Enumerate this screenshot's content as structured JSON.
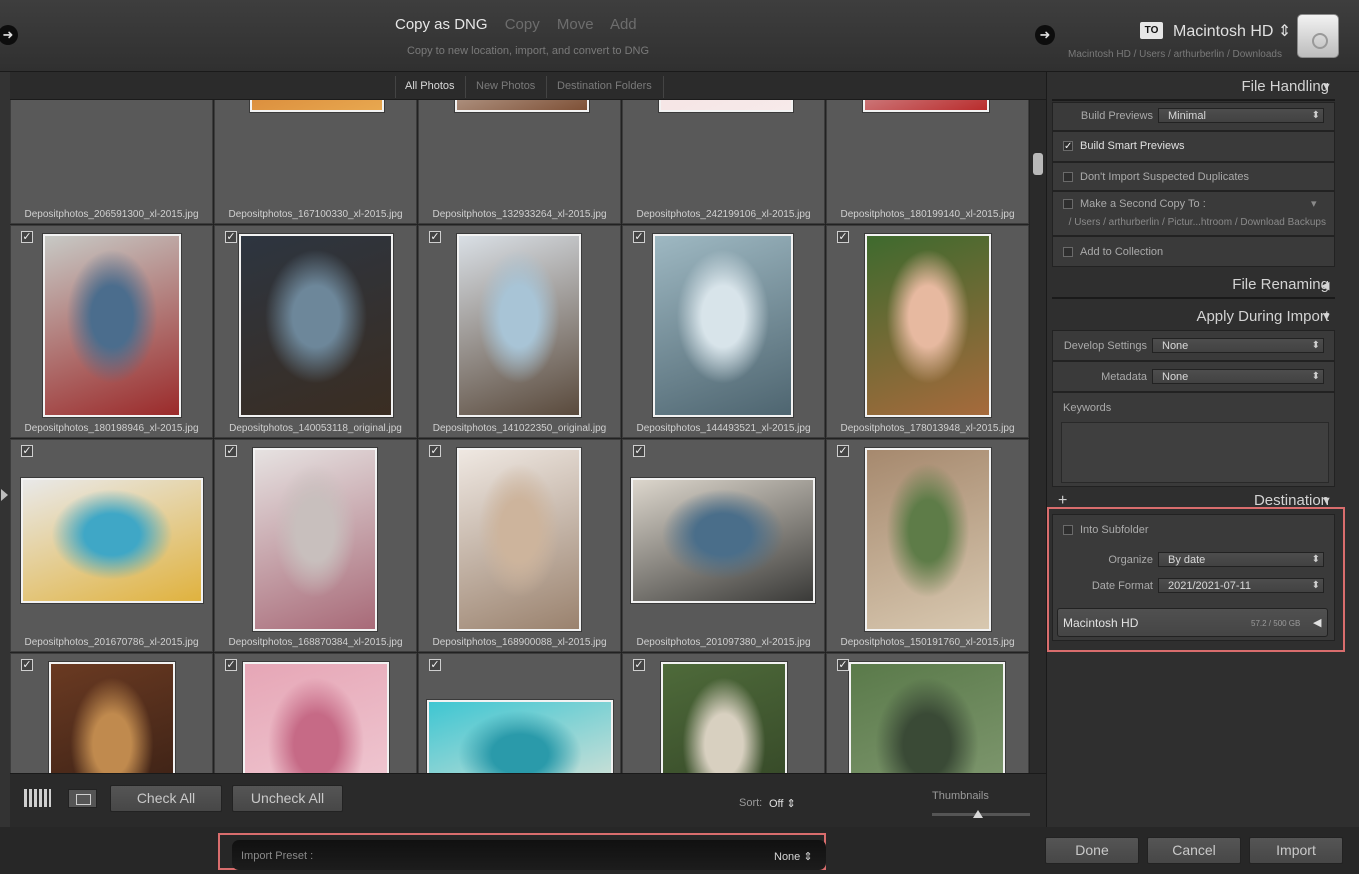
{
  "top": {
    "modes": [
      "Copy as DNG",
      "Copy",
      "Move",
      "Add"
    ],
    "active_mode": "Copy as DNG",
    "mode_description": "Copy to new location, import, and convert to DNG",
    "to_badge": "TO",
    "destination_name": "Macintosh HD ⇕",
    "destination_path": "Macintosh HD / Users / arthurberlin / Downloads",
    "nav_left_icon": "arrow-right-circle-icon",
    "nav_right_icon": "arrow-right-circle-icon",
    "disk_icon": "hard-drive-icon"
  },
  "grid_tabs": [
    "All Photos",
    "New Photos",
    "Destination Folders"
  ],
  "photos": [
    {
      "file": "Depositphotos_206591300_xl-2015.jpg",
      "checked": false,
      "colors": [
        "#b25a2a",
        "#e09a5a",
        "#6a3a1e"
      ]
    },
    {
      "file": "Depositphotos_167100330_xl-2015.jpg",
      "checked": false,
      "colors": [
        "#c96a23",
        "#7a3414",
        "#e8a850"
      ]
    },
    {
      "file": "Depositphotos_132933264_xl-2015.jpg",
      "checked": false,
      "colors": [
        "#efeae4",
        "#b9aca0",
        "#7e5036"
      ]
    },
    {
      "file": "Depositphotos_242199106_xl-2015.jpg",
      "checked": false,
      "colors": [
        "#f3dede",
        "#eeb6bd",
        "#f7eaea"
      ]
    },
    {
      "file": "Depositphotos_180199140_xl-2015.jpg",
      "checked": false,
      "colors": [
        "#e8e9ee",
        "#c6c9d2",
        "#b92b2b"
      ]
    },
    {
      "file": "Depositphotos_180198946_xl-2015.jpg",
      "checked": true,
      "colors": [
        "#c7c9c5",
        "#4b6d8d",
        "#9b2a2a"
      ]
    },
    {
      "file": "Depositphotos_140053118_original.jpg",
      "checked": true,
      "colors": [
        "#2d3540",
        "#6d879a",
        "#3a2d22"
      ]
    },
    {
      "file": "Depositphotos_141022350_original.jpg",
      "checked": true,
      "colors": [
        "#d9dfe5",
        "#a8c4d6",
        "#5a4a3c"
      ]
    },
    {
      "file": "Depositphotos_144493521_xl-2015.jpg",
      "checked": true,
      "colors": [
        "#9eb8c2",
        "#d8e4ea",
        "#4e6570"
      ]
    },
    {
      "file": "Depositphotos_178013948_xl-2015.jpg",
      "checked": true,
      "colors": [
        "#3e6a2e",
        "#e7b9a0",
        "#a66a3c"
      ]
    },
    {
      "file": "Depositphotos_201670786_xl-2015.jpg",
      "checked": true,
      "colors": [
        "#e9e9e9",
        "#3fa7c6",
        "#e0b23e"
      ]
    },
    {
      "file": "Depositphotos_168870384_xl-2015.jpg",
      "checked": true,
      "colors": [
        "#e6e2e1",
        "#c8bfbd",
        "#a86a78"
      ]
    },
    {
      "file": "Depositphotos_168900088_xl-2015.jpg",
      "checked": true,
      "colors": [
        "#efe8e2",
        "#cdb49c",
        "#9a826e"
      ]
    },
    {
      "file": "Depositphotos_201097380_xl-2015.jpg",
      "checked": true,
      "colors": [
        "#dcd6cc",
        "#4a6e8a",
        "#3a3a38"
      ]
    },
    {
      "file": "Depositphotos_150191760_xl-2015.jpg",
      "checked": true,
      "colors": [
        "#a6896e",
        "#5e7c48",
        "#d8c8b0"
      ]
    },
    {
      "file": "",
      "checked": true,
      "colors": [
        "#6a3a22",
        "#c08a4e",
        "#2e1a12"
      ]
    },
    {
      "file": "",
      "checked": true,
      "colors": [
        "#e6a6b6",
        "#c66a86",
        "#f2d2da"
      ]
    },
    {
      "file": "",
      "checked": true,
      "colors": [
        "#3ec6d2",
        "#2a9aaa",
        "#f0e6d8"
      ]
    },
    {
      "file": "",
      "checked": true,
      "colors": [
        "#4e6a3a",
        "#d8d0c0",
        "#2e3e22"
      ]
    },
    {
      "file": "",
      "checked": true,
      "colors": [
        "#5a7a4a",
        "#3a4a36",
        "#8aa07a"
      ]
    }
  ],
  "toolbar": {
    "check_all": "Check All",
    "uncheck_all": "Uncheck All",
    "sort_label": "Sort:",
    "sort_value": "Off ⇕",
    "thumbnails_label": "Thumbnails",
    "thumbnail_size": 0.47
  },
  "preset": {
    "label": "Import Preset :",
    "value": "None ⇕"
  },
  "actions": {
    "done": "Done",
    "cancel": "Cancel",
    "import": "Import"
  },
  "panel": {
    "file_handling": {
      "title": "File Handling",
      "build_previews_label": "Build Previews",
      "build_previews_value": "Minimal",
      "smart_previews": {
        "label": "Build Smart Previews",
        "checked": true
      },
      "no_duplicates": {
        "label": "Don't Import Suspected Duplicates",
        "checked": false
      },
      "second_copy": {
        "label": "Make a Second Copy To :",
        "checked": false,
        "path": "/ Users / arthurberlin / Pictur...htroom / Download Backups"
      },
      "add_collection": {
        "label": "Add to Collection",
        "checked": false
      }
    },
    "file_renaming": {
      "title": "File Renaming"
    },
    "apply_during_import": {
      "title": "Apply During Import",
      "develop_label": "Develop Settings",
      "develop_value": "None",
      "metadata_label": "Metadata",
      "metadata_value": "None",
      "keywords_label": "Keywords"
    },
    "destination": {
      "title": "Destination",
      "into_subfolder": {
        "label": "Into Subfolder",
        "checked": false
      },
      "organize_label": "Organize",
      "organize_value": "By date",
      "date_format_label": "Date Format",
      "date_format_value": "2021/2021-07-11",
      "volume_name": "Macintosh HD",
      "volume_size": "57.2 / 500 GB"
    }
  },
  "colors": {
    "highlight": "#d96d6d",
    "panel": "#2f2f2f",
    "cell": "#595959"
  }
}
